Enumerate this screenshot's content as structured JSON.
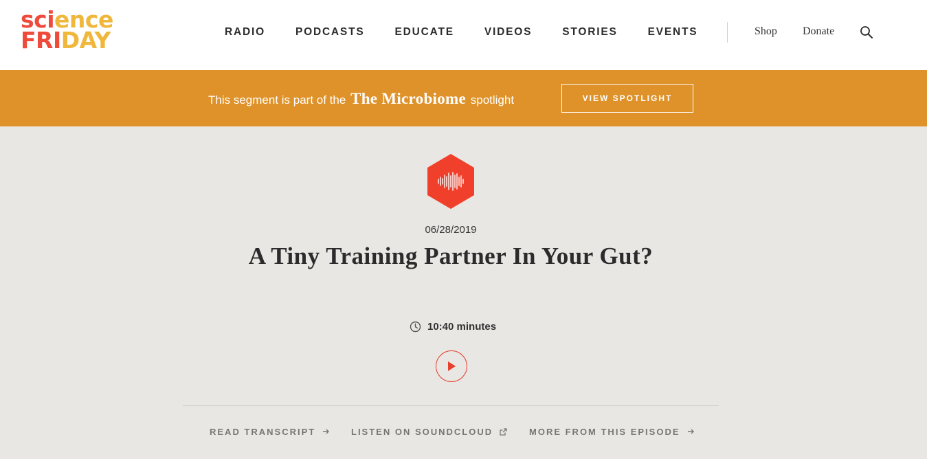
{
  "brand": {
    "logo_line1_a": "sci",
    "logo_line1_b": "ence",
    "logo_line2_a": "FRI",
    "logo_line2_b": "DAY",
    "colors": {
      "red": "#ef4b3b",
      "yellow": "#f0b73d"
    }
  },
  "nav": {
    "items": [
      {
        "label": "RADIO"
      },
      {
        "label": "PODCASTS"
      },
      {
        "label": "EDUCATE"
      },
      {
        "label": "VIDEOS"
      },
      {
        "label": "STORIES"
      },
      {
        "label": "EVENTS"
      }
    ],
    "shop": "Shop",
    "donate": "Donate",
    "search_icon": "search-icon"
  },
  "banner": {
    "prefix": "This segment is part of the",
    "spotlight_name": "The Microbiome",
    "suffix": "spotlight",
    "button": "VIEW SPOTLIGHT",
    "color": "#df9229"
  },
  "segment": {
    "icon": "audio-waveform-hexagon-icon",
    "icon_color": "#f0402b",
    "date": "06/28/2019",
    "title": "A Tiny Training Partner In Your Gut?",
    "duration": "10:40 minutes",
    "play_icon": "play-icon"
  },
  "links": [
    {
      "label": "READ TRANSCRIPT",
      "icon": "arrow-right-icon"
    },
    {
      "label": "LISTEN ON SOUNDCLOUD",
      "icon": "external-link-icon"
    },
    {
      "label": "MORE FROM THIS EPISODE",
      "icon": "arrow-right-icon"
    }
  ]
}
